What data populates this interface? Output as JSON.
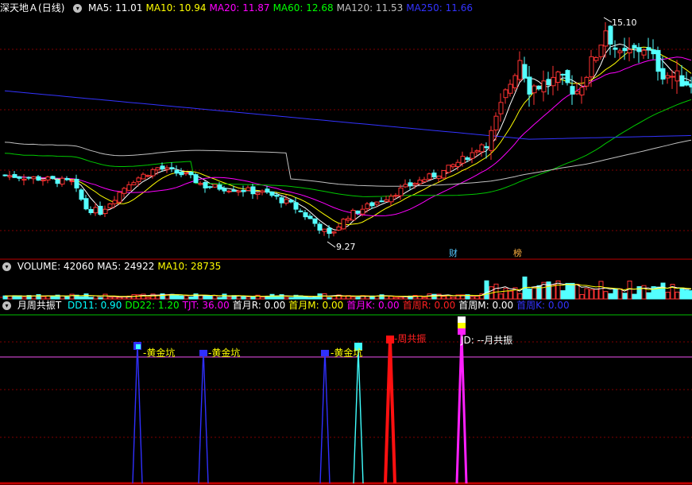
{
  "price_panel": {
    "title": "深天地Ａ",
    "period": "(日线)",
    "ma": [
      {
        "label": "MA5",
        "value": "11.01",
        "color": "#ffffff"
      },
      {
        "label": "MA10",
        "value": "10.94",
        "color": "#ffff00"
      },
      {
        "label": "MA20",
        "value": "11.87",
        "color": "#ff00ff"
      },
      {
        "label": "MA60",
        "value": "12.68",
        "color": "#00ff00"
      },
      {
        "label": "MA120",
        "value": "11.53",
        "color": "#c0c0c0"
      },
      {
        "label": "MA250",
        "value": "11.66",
        "color": "#3333ff"
      }
    ],
    "high_label": "15.10",
    "low_label": "9.27",
    "tag_cai": "财",
    "tag_bang": "榜"
  },
  "volume_panel": {
    "items": [
      {
        "label": "VOLUME",
        "value": "42060",
        "color": "#ffffff"
      },
      {
        "label": "MA5",
        "value": "24922",
        "color": "#ffffff"
      },
      {
        "label": "MA10",
        "value": "28735",
        "color": "#ffff00"
      }
    ]
  },
  "indicator_panel": {
    "title": "月周共振T",
    "items": [
      {
        "label": "DD11",
        "value": "0.90",
        "color": "#00ffff"
      },
      {
        "label": "DD22",
        "value": "1.20",
        "color": "#00ff00"
      },
      {
        "label": "TJT",
        "value": "36.00",
        "color": "#ff00ff"
      },
      {
        "label": "首月R",
        "value": "0.00",
        "color": "#ffffff"
      },
      {
        "label": "首月M",
        "value": "0.00",
        "color": "#ffff00"
      },
      {
        "label": "首月K",
        "value": "0.00",
        "color": "#ff00ff"
      },
      {
        "label": "首周R",
        "value": "0.00",
        "color": "#ff2020"
      },
      {
        "label": "首周M",
        "value": "0.00",
        "color": "#ffffff"
      },
      {
        "label": "首周K",
        "value": "0.00",
        "color": "#3333ff"
      }
    ],
    "signals": {
      "huangjinkeng": "-黄金坑",
      "zhougongzhen": "-周共振",
      "yuegongzhen": "JD: --月共振"
    }
  },
  "colors": {
    "up": "#ff3232",
    "down": "#54ffff",
    "background": "#000000",
    "divider": "#c00000"
  }
}
